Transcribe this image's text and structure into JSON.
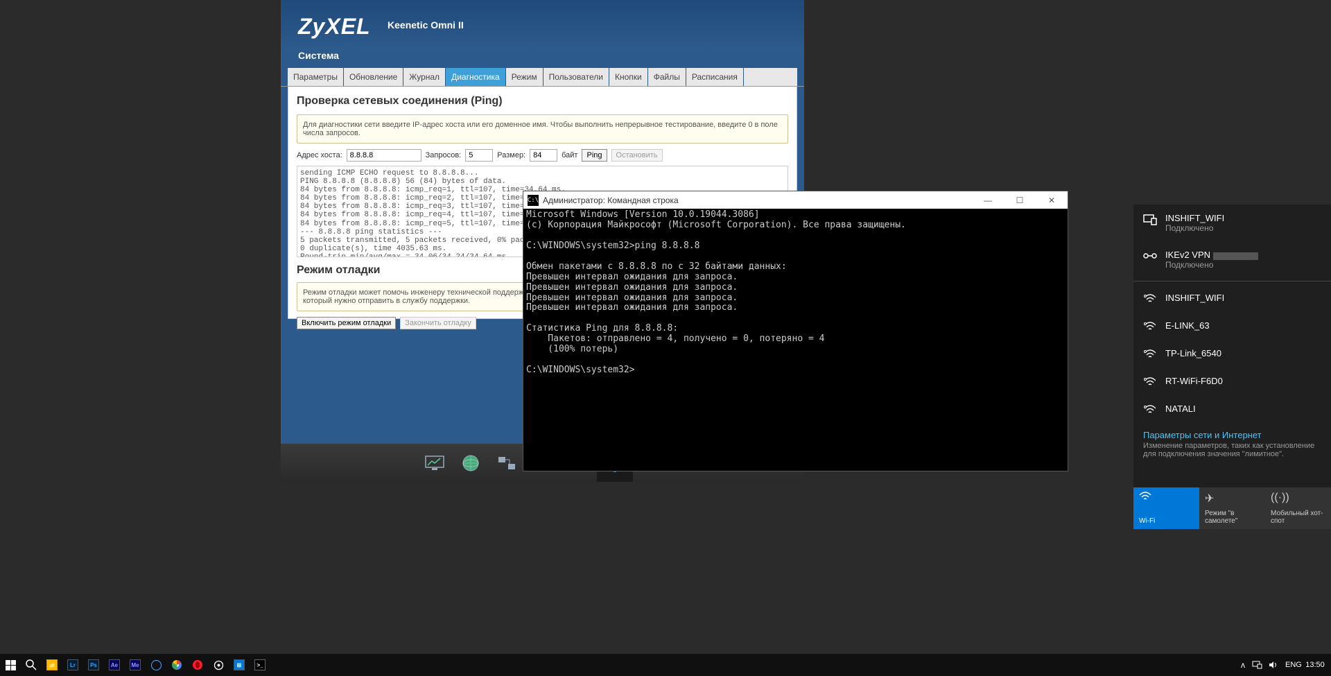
{
  "router": {
    "brand": "ZyXEL",
    "model": "Keenetic Omni II",
    "section": "Система",
    "tabs": [
      "Параметры",
      "Обновление",
      "Журнал",
      "Диагностика",
      "Режим",
      "Пользователи",
      "Кнопки",
      "Файлы",
      "Расписания"
    ],
    "active_tab": 3,
    "ping": {
      "title": "Проверка сетевых соединения (Ping)",
      "hint": "Для диагностики сети введите IP-адрес хоста или его доменное имя. Чтобы выполнить непрерывное тестирование, введите 0 в поле числа запросов.",
      "host_label": "Адрес хоста:",
      "host_value": "8.8.8.8",
      "count_label": "Запросов:",
      "count_value": "5",
      "size_label": "Размер:",
      "size_value": "84",
      "unit_label": "байт",
      "go_label": "Ping",
      "stop_label": "Остановить",
      "output": "sending ICMP ECHO request to 8.8.8.8...\nPING 8.8.8.8 (8.8.8.8) 56 (84) bytes of data.\n84 bytes from 8.8.8.8: icmp_req=1, ttl=107, time=34.64 ms.\n84 bytes from 8.8.8.8: icmp_req=2, ttl=107, time=34.06 ms.\n84 bytes from 8.8.8.8: icmp_req=3, ttl=107, time=34.28 ms.\n84 bytes from 8.8.8.8: icmp_req=4, ttl=107, time=34.16 ms.\n84 bytes from 8.8.8.8: icmp_req=5, ttl=107, time=34.07 ms.\n--- 8.8.8.8 ping statistics ---\n5 packets transmitted, 5 packets received, 0% packet loss,\n0 duplicate(s), time 4035.63 ms.\nRound-trip min/avg/max = 34.06/34.24/34.64 ms."
    },
    "debug": {
      "title": "Режим отладки",
      "hint": "Режим отладки может помочь инженеру технической поддержки в диагностике. Включив режим отладки, вы получите файл self-test, который нужно отправить в службу поддержки.",
      "enable_label": "Включить режим отладки",
      "finish_label": "Закончить отладку"
    }
  },
  "cmd": {
    "title": "Администратор: Командная строка",
    "body": "Microsoft Windows [Version 10.0.19044.3086]\n(c) Корпорация Майкрософт (Microsoft Corporation). Все права защищены.\n\nC:\\WINDOWS\\system32>ping 8.8.8.8\n\nОбмен пакетами с 8.8.8.8 по с 32 байтами данных:\nПревышен интервал ожидания для запроса.\nПревышен интервал ожидания для запроса.\nПревышен интервал ожидания для запроса.\nПревышен интервал ожидания для запроса.\n\nСтатистика Ping для 8.8.8.8:\n    Пакетов: отправлено = 4, получено = 0, потеряно = 4\n    (100% потерь)\n\nC:\\WINDOWS\\system32>"
  },
  "wifi": {
    "connected": [
      {
        "name": "INSHIFT_WIFI",
        "status": "Подключено",
        "type": "ethernet"
      },
      {
        "name": "IKEv2 VPN",
        "status": "Подключено",
        "type": "vpn"
      }
    ],
    "available": [
      "INSHIFT_WIFI",
      "E-LINK_63",
      "TP-Link_6540",
      "RT-WiFi-F6D0",
      "NATALI"
    ],
    "settings_title": "Параметры сети и Интернет",
    "settings_desc": "Изменение параметров, таких как установление для подключения значения \"лимитное\".",
    "tiles": {
      "wifi": "Wi-Fi",
      "airplane": "Режим \"в самолете\"",
      "hotspot": "Мобильный хот-спот"
    }
  },
  "taskbar": {
    "lang": "ENG",
    "time": "13:50"
  }
}
